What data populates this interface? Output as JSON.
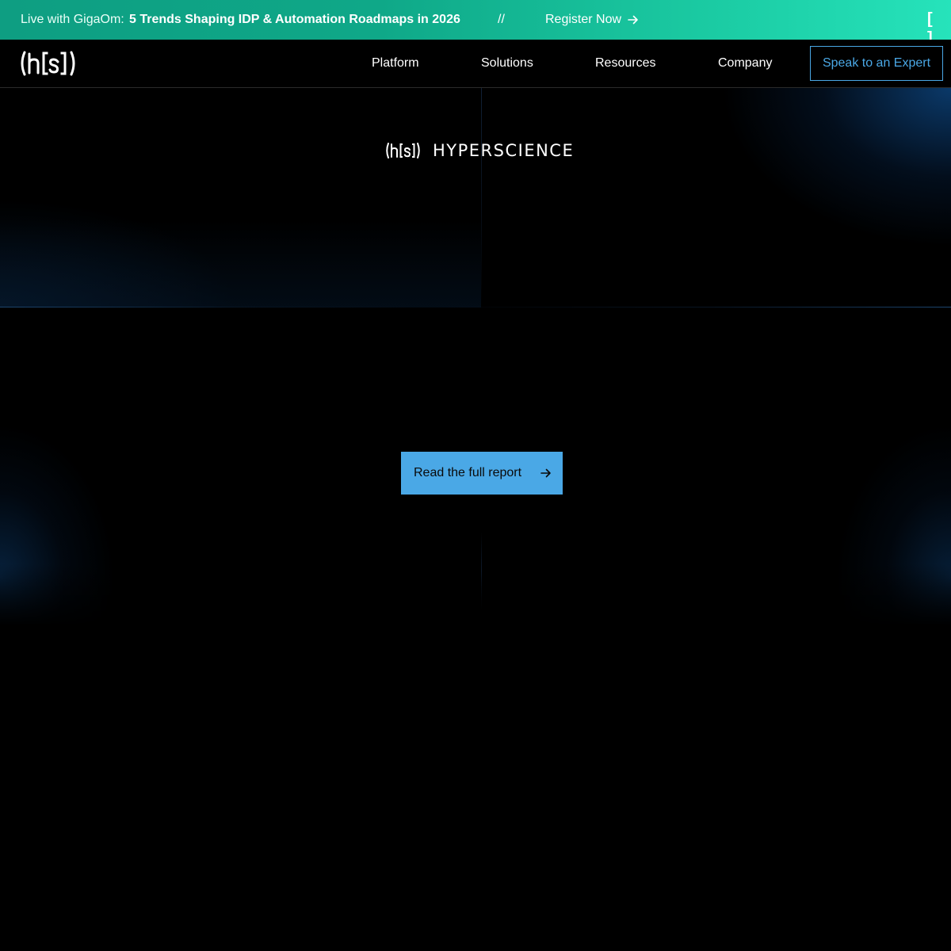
{
  "banner": {
    "prefix": "Live with GigaOm:",
    "headline": "5 Trends Shaping IDP & Automation Roadmaps in 2026",
    "separator": "//",
    "register_label": "Register Now",
    "close_label": "[ ]",
    "icons": {
      "register": "arrow-right-icon",
      "close": "bracket-close-icon"
    },
    "gradient_colors": [
      "#0e9e82",
      "#26e3bb"
    ]
  },
  "nav": {
    "logo_text": "(h[s])",
    "items": [
      {
        "label": "Platform"
      },
      {
        "label": "Solutions"
      },
      {
        "label": "Resources"
      },
      {
        "label": "Company"
      }
    ],
    "cta_label": "Speak to an Expert",
    "accent_color": "#4aa8e6"
  },
  "hero": {
    "brand_mark": "(h[s])",
    "brand_name": "HYPERSCIENCE",
    "cta_label": "Read the full report",
    "cta_icon": "arrow-right-icon",
    "cta_color": "#4aa8e6"
  }
}
